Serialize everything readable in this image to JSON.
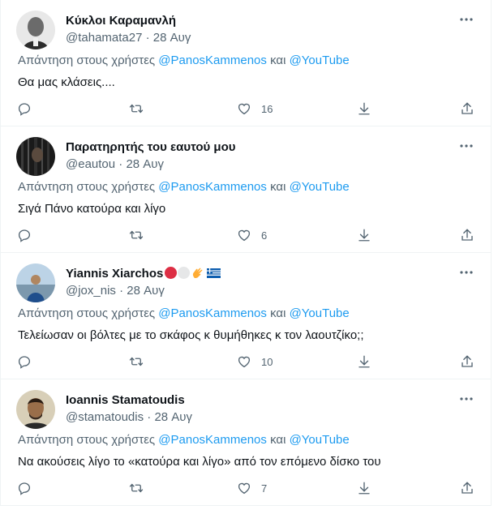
{
  "tweets": [
    {
      "name": "Κύκλοι Καραμανλή",
      "handle": "@tahamata27",
      "date": "28 Αυγ",
      "reply_prefix": "Απάντηση στους χρήστες ",
      "mention1": "@PanosKammenos",
      "conj": " και ",
      "mention2": "@YouTube",
      "text": "Θα μας κλάσεις....",
      "likes": "16"
    },
    {
      "name": "Παρατηρητής του εαυτού μου",
      "handle": "@eautou",
      "date": "28 Αυγ",
      "reply_prefix": "Απάντηση στους χρήστες ",
      "mention1": "@PanosKammenos",
      "conj": " και ",
      "mention2": "@YouTube",
      "text": "Σιγά Πάνο κατούρα και λίγο",
      "likes": "6"
    },
    {
      "name": "Yiannis Xiarchos",
      "handle": "@jox_nis",
      "date": "28 Αυγ",
      "reply_prefix": "Απάντηση στους χρήστες ",
      "mention1": "@PanosKammenos",
      "conj": " και ",
      "mention2": "@YouTube",
      "text": "Τελείωσαν οι βόλτες με το σκάφος κ θυμήθηκες κ τον λαουτζίκο;;",
      "likes": "10"
    },
    {
      "name": "Ioannis Stamatoudis",
      "handle": "@stamatoudis",
      "date": "28 Αυγ",
      "reply_prefix": "Απάντηση στους χρήστες ",
      "mention1": "@PanosKammenos",
      "conj": " και ",
      "mention2": "@YouTube",
      "text": "Να ακούσεις λίγο το «κατούρα και λίγο» από τον επόμενο δίσκο του",
      "likes": "7"
    }
  ],
  "separator": " · ",
  "icons": [
    "more-icon",
    "reply-icon",
    "retweet-icon",
    "like-icon",
    "download-icon",
    "share-icon"
  ],
  "colors": {
    "mention": "#1d9bf0",
    "secondary": "#536471",
    "text": "#0f1419"
  }
}
